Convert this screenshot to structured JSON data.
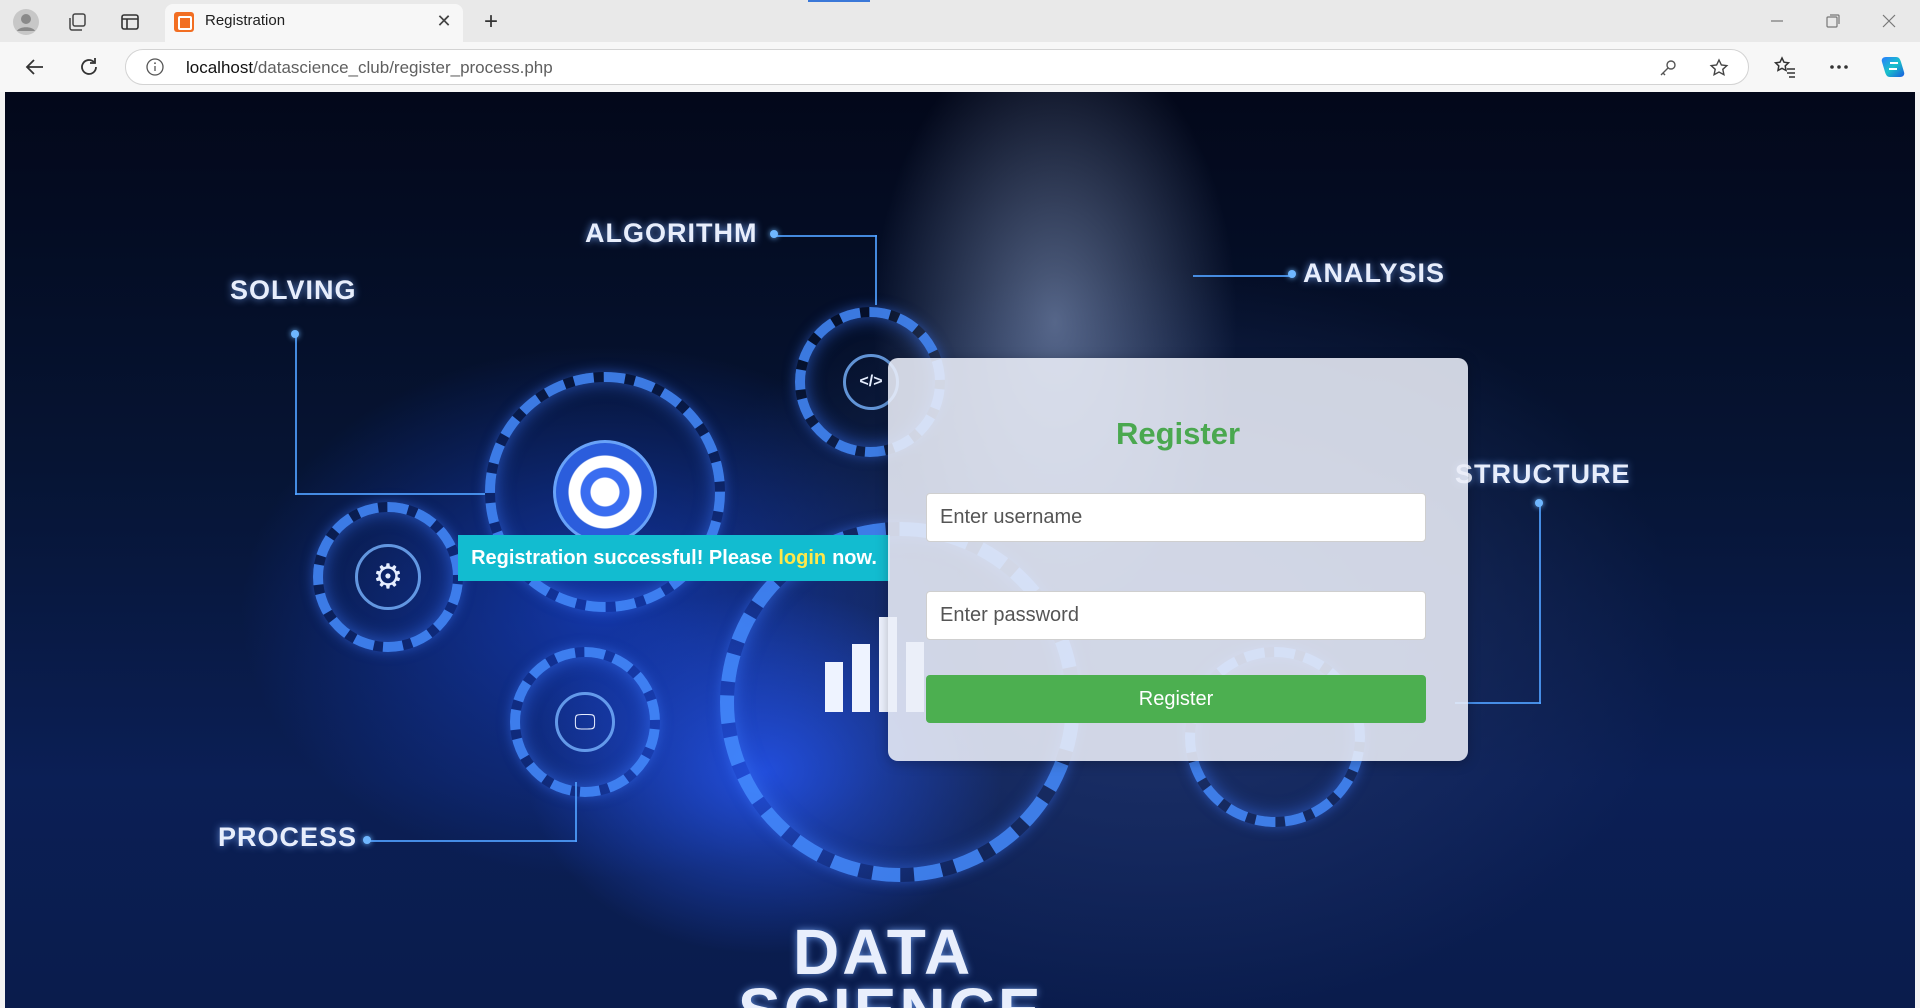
{
  "browser": {
    "tab_title": "Registration",
    "url_host": "localhost",
    "url_path": "/datascience_club/register_process.php"
  },
  "background": {
    "labels": {
      "algorithm": "ALGORITHM",
      "solving": "SOLVING",
      "analysis": "ANALYSIS",
      "structure": "STRUCTURE",
      "process": "PROCESS",
      "data": "DATA",
      "science": "SCIENCE"
    },
    "code_glyph": "</>"
  },
  "message": {
    "prefix": "Registration successful! Please",
    "link": "login",
    "suffix": "now.",
    "link_color": "#ffe84a",
    "bg_color": "#12bcd0"
  },
  "form": {
    "title": "Register",
    "username_placeholder": "Enter username",
    "password_placeholder": "Enter password",
    "submit_label": "Register",
    "accent": "#4caf50"
  }
}
